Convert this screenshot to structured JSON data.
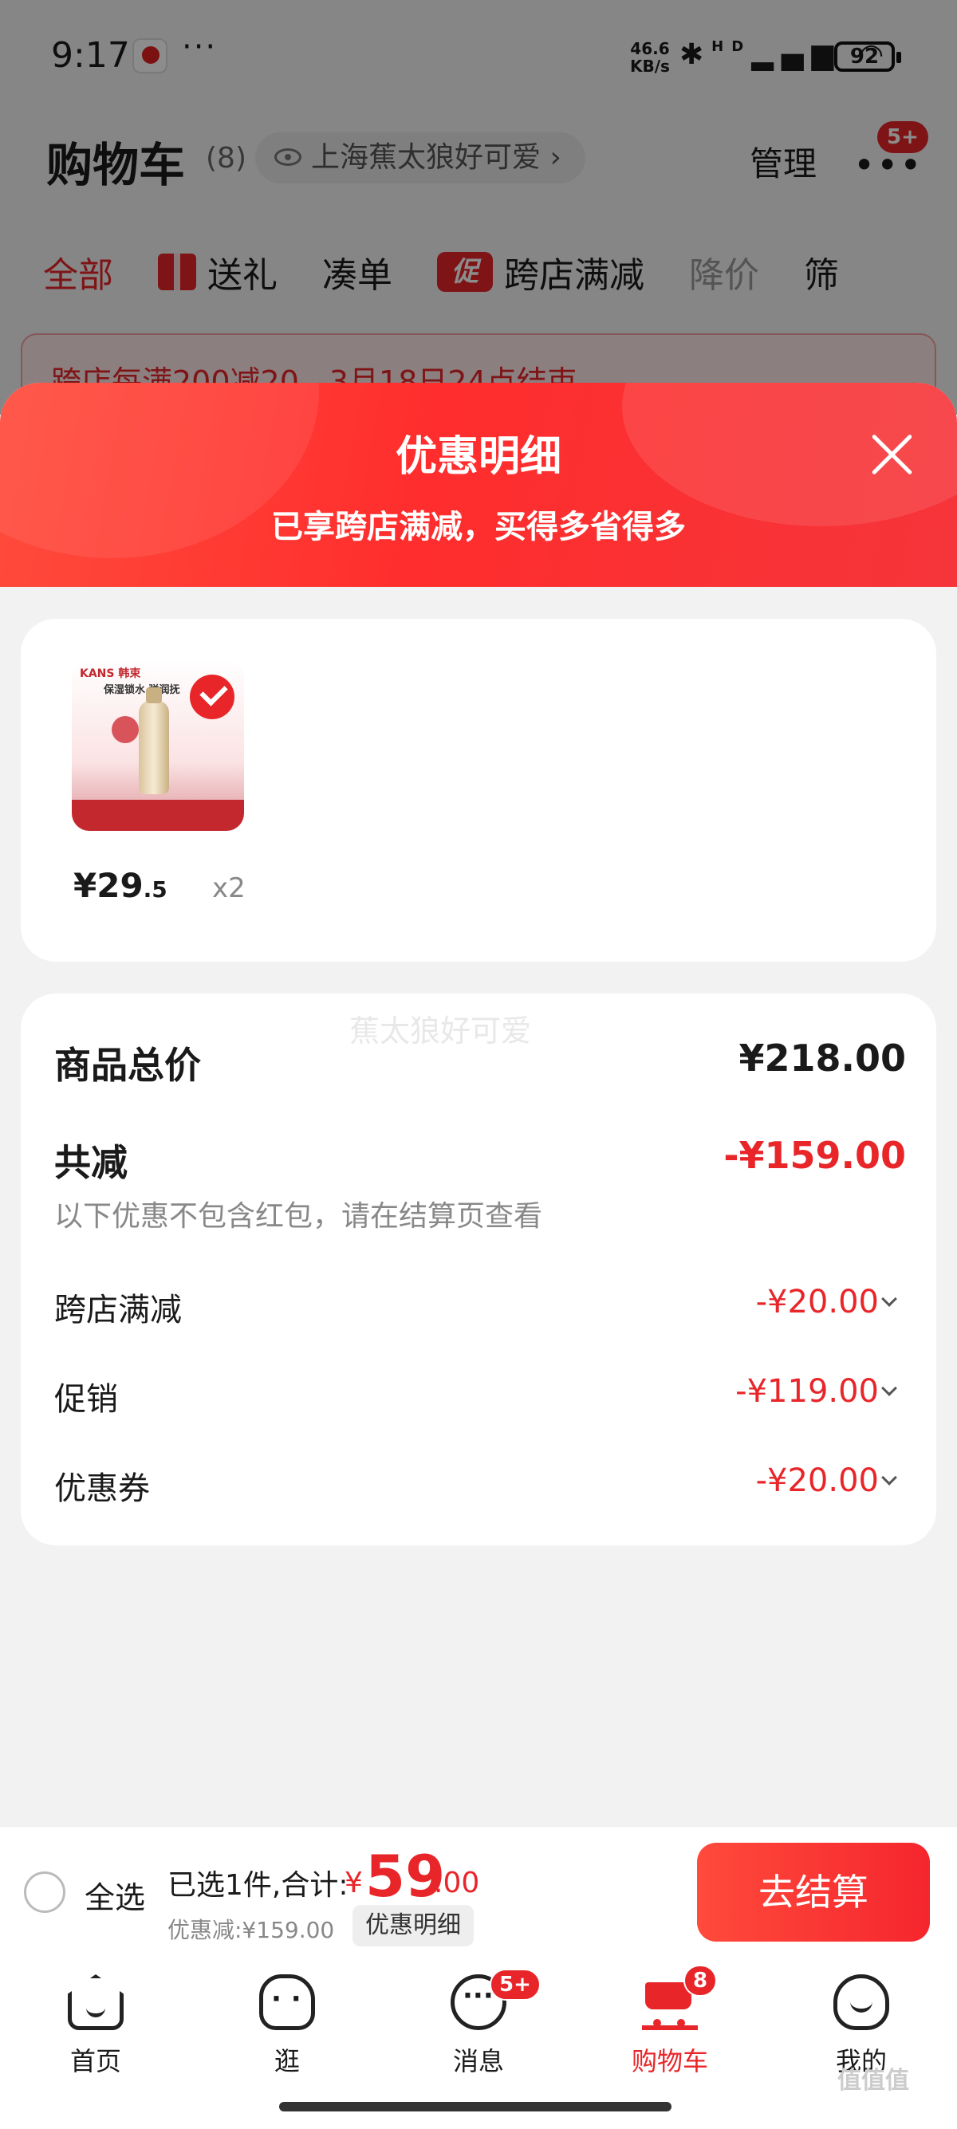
{
  "status_bar": {
    "time": "9:17",
    "dots": "···",
    "net_speed_value": "46.6",
    "net_speed_unit": "KB/s",
    "indicators": "HD",
    "battery": "92"
  },
  "cart_header": {
    "title": "购物车",
    "count": "(8)",
    "location": "上海蕉太狼好可爱",
    "manage": "管理",
    "more_badge": "5+"
  },
  "filter_tabs": [
    {
      "label": "全部"
    },
    {
      "label": "送礼"
    },
    {
      "label": "凑单"
    },
    {
      "label": "跨店满减",
      "icon_text": "促"
    },
    {
      "label": "降价"
    },
    {
      "label": "筛"
    }
  ],
  "notice": {
    "text": "跨店每满200减20，3月18日24点结束"
  },
  "sheet": {
    "title": "优惠明细",
    "subtitle": "已享跨店满减，买得多省得多",
    "product": {
      "brand": "KANS 韩束",
      "tagline": "保湿锁水 弹润抚",
      "price_int": "¥29",
      "price_dec": ".5",
      "quantity": "x2"
    },
    "watermark": "蕉太狼好可爱",
    "summary": {
      "total_label": "商品总价",
      "total_value": "¥218.00",
      "reduction_label": "共减",
      "reduction_value": "-¥159.00",
      "note": "以下优惠不包含红包，请在结算页查看",
      "items": [
        {
          "label": "跨店满减",
          "value": "-¥20.00"
        },
        {
          "label": "促销",
          "value": "-¥119.00"
        },
        {
          "label": "优惠券",
          "value": "-¥20.00"
        }
      ]
    }
  },
  "checkout": {
    "select_all": "全选",
    "selected_text": "已选1件,合计:",
    "currency": "¥",
    "total_int": "59",
    "total_dec": ".00",
    "discount_text": "优惠减:¥159.00",
    "detail_button": "优惠明细",
    "checkout_button": "去结算"
  },
  "tabbar": [
    {
      "label": "首页"
    },
    {
      "label": "逛"
    },
    {
      "label": "消息",
      "badge": "5+"
    },
    {
      "label": "购物车",
      "badge": "8"
    },
    {
      "label": "我的"
    }
  ],
  "site_mark": "值值值",
  "colors": {
    "accent": "#e8262a",
    "header_gradient_start": "#ff4b3c",
    "background": "#f2f2f2"
  }
}
